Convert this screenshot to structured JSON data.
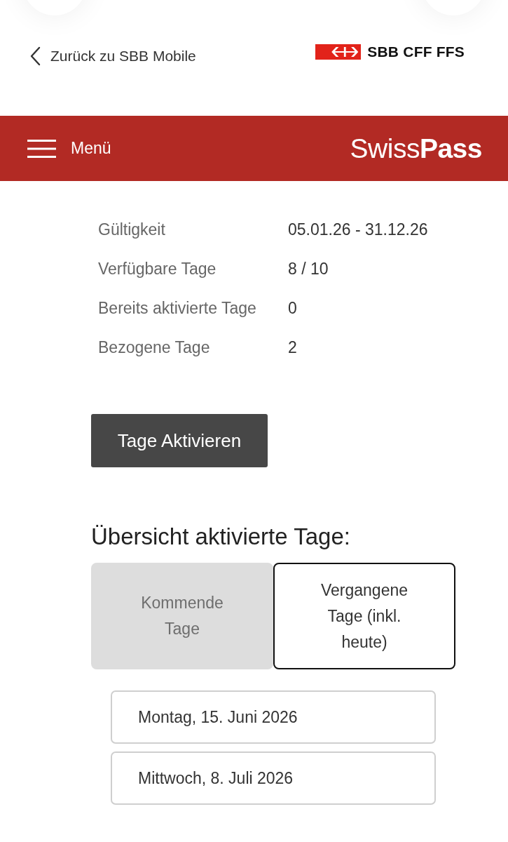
{
  "top_bar": {
    "back_link": "Zurück zu SBB Mobile",
    "logo_text": "SBB CFF FFS"
  },
  "header": {
    "menu_label": "Menü",
    "brand": "Swiss**Pass**"
  },
  "details": [
    {
      "label": "Gültigkeit",
      "value": "05.01.26 - 31.12.26"
    },
    {
      "label": "Verfügbare Tage",
      "value": "8 / 10"
    },
    {
      "label": "Bereits aktivierte Tage",
      "value": "0"
    },
    {
      "label": "Bezogene Tage",
      "value": "2"
    }
  ],
  "activate_button": "Tage Aktivieren",
  "overview": {
    "heading": "Übersicht aktivierte Tage:",
    "tabs": [
      {
        "label": "Kommende Tage",
        "selected": false
      },
      {
        "label": "Vergangene Tage (inkl. heute)",
        "selected": true
      }
    ],
    "days": [
      "Montag, 15. Juni 2026",
      "Mittwoch, 8. Juli 2026"
    ]
  }
}
